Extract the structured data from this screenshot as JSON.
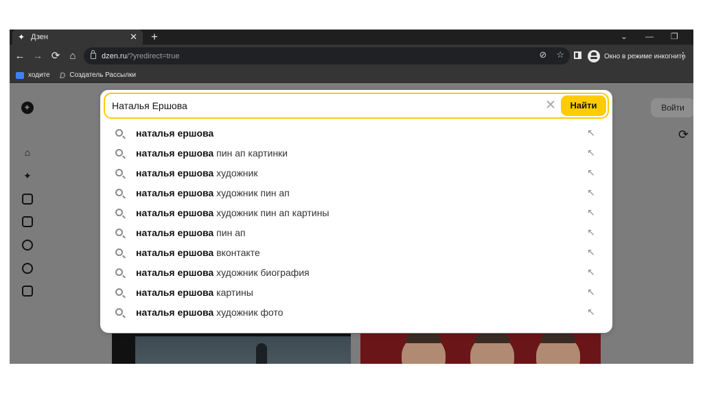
{
  "browser": {
    "tab": {
      "favicon": "dzen-star-icon",
      "title": "Дзен",
      "close_glyph": "✕"
    },
    "new_tab_glyph": "+",
    "window_controls": {
      "dropdown": "⌄",
      "minimize": "—",
      "restore": "❐"
    },
    "nav": {
      "back": "←",
      "forward": "→",
      "reload": "⟳",
      "home": "⌂"
    },
    "url": {
      "host": "dzen.ru",
      "path": "/?yredirect=true"
    },
    "omnibox_icons": {
      "eye_off": "⊘",
      "star": "☆"
    },
    "incognito_label": "Окно в режиме инкогнито",
    "menu_glyph": "⋮",
    "bookmarks": [
      {
        "label": "ходите"
      },
      {
        "label": "Создатель Рассылки",
        "icon_glyph": "D"
      }
    ]
  },
  "page": {
    "login_button": "Войти",
    "sidebar_icons": [
      "home-icon",
      "sparkle-icon",
      "video-icon",
      "article-icon",
      "shorts-icon",
      "channels-icon",
      "tasks-icon"
    ]
  },
  "search": {
    "query": "Наталья Ершова",
    "clear_glyph": "✕",
    "find_button": "Найти",
    "arrow_glyph": "↖",
    "suggestions": [
      {
        "bold": "наталья ершова",
        "rest": ""
      },
      {
        "bold": "наталья ершова",
        "rest": " пин ап картинки"
      },
      {
        "bold": "наталья ершова",
        "rest": " художник"
      },
      {
        "bold": "наталья ершова",
        "rest": " художник пин ап"
      },
      {
        "bold": "наталья ершова",
        "rest": " художник пин ап картины"
      },
      {
        "bold": "наталья ершова",
        "rest": " пин ап"
      },
      {
        "bold": "наталья ершова",
        "rest": " вконтакте"
      },
      {
        "bold": "наталья ершова",
        "rest": " художник биография"
      },
      {
        "bold": "наталья ершова",
        "rest": " картины"
      },
      {
        "bold": "наталья ершова",
        "rest": " художник фото"
      }
    ]
  },
  "colors": {
    "accent": "#ffcc00",
    "chrome_dark": "#353535",
    "overlay": "#7c7c7c"
  }
}
